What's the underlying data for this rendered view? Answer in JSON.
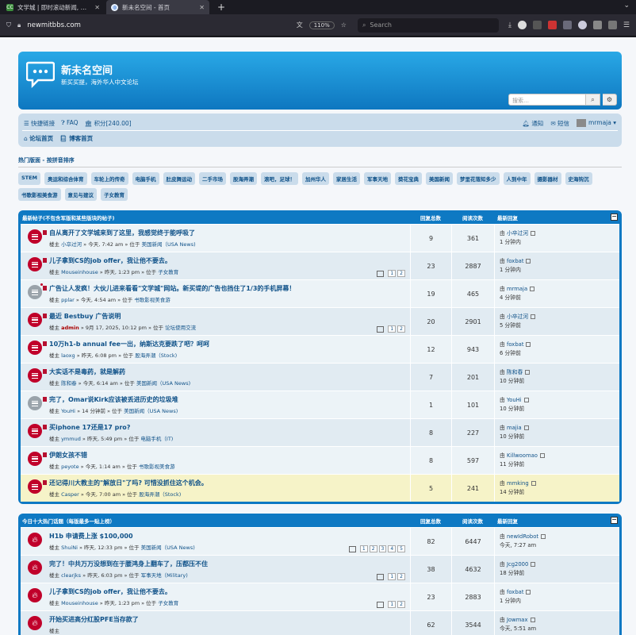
{
  "browser": {
    "tabs": [
      {
        "favicon": "CC",
        "title": "文学城 | 即时滚动新闻, 本地新闻,",
        "active": false
      },
      {
        "favicon": "globe",
        "title": "新未名空间 - 首页",
        "active": true
      }
    ],
    "url": "newmitbbs.com",
    "zoom": "110%",
    "search_placeholder": "Search",
    "ext_badge": "2"
  },
  "site": {
    "title": "新未名空间",
    "desc": "新买买提，海外华人中文论坛",
    "search_placeholder": "搜索…"
  },
  "nav": {
    "quicklinks": "快捷链接",
    "faq": "FAQ",
    "points": "积分[240.00]",
    "notify": "通知",
    "pm": "短信",
    "user": "mrmaja",
    "forum_home": "论坛首页",
    "blog_home": "博客首页"
  },
  "hot": {
    "title": "热门版面 - 按拼音排序",
    "tags": [
      "STEM",
      "奥运和综合体育",
      "车轮上的传奇",
      "电脑手机",
      "肚皮舞运动",
      "二手市场",
      "股海弄潮",
      "滚吧，足球！",
      "加州华人",
      "家居生活",
      "军事天地",
      "葵花宝典",
      "美国新闻",
      "梦里花落知多少",
      "人到中年",
      "摄影器材",
      "史海钩沉",
      "书歌影视美食游",
      "意见与建议",
      "子女教育"
    ]
  },
  "box1": {
    "header": "最新帖子(不包含军版和某些版块的帖子)",
    "col_replies": "回复总数",
    "col_views": "阅读次数",
    "col_last": "最新回复",
    "rows": [
      {
        "title": "自从离开了文学城来到了这里，我感觉终于能呼吸了",
        "prefix": "楼主",
        "author": "小卒过河",
        "time": "» 今天, 7:42 am » 位于",
        "forum": "美国新闻（USA News)",
        "replies": "9",
        "views": "361",
        "last_user": "小卒过河",
        "last_time": "1 分钟内",
        "last_prefix": "由",
        "pages": [],
        "admin": false
      },
      {
        "title": "儿子拿到CS的job offer，我让他不要去。",
        "prefix": "楼主",
        "author": "Mouseinhouse",
        "time": "» 昨天, 1:23 pm » 位于",
        "forum": "子女教育",
        "replies": "23",
        "views": "2887",
        "last_user": "foxbat",
        "last_time": "1 分钟内",
        "last_prefix": "由",
        "pages": [
          "1",
          "2"
        ],
        "admin": false
      },
      {
        "title": "广告让人发疯！大伙儿进来看看\"文学城\"网站。新买堤的广告也挡住了1/3的手机屏幕！",
        "prefix": "楼主",
        "author": "pplar",
        "time": "» 今天, 4:54 am » 位于",
        "forum": "书歌影视美食游",
        "replies": "19",
        "views": "465",
        "last_user": "mrmaja",
        "last_time": "4 分钟前",
        "last_prefix": "由",
        "pages": [],
        "admin": false
      },
      {
        "title": "最近 Bestbuy 广告说明",
        "prefix": "楼主",
        "author": "admin",
        "time": "» 9月 17, 2025, 10:12 pm » 位于",
        "forum": "论坛使用交流",
        "replies": "20",
        "views": "2901",
        "last_user": "小卒过河",
        "last_time": "5 分钟前",
        "last_prefix": "由",
        "pages": [
          "1",
          "2"
        ],
        "admin": true
      },
      {
        "title": "10万h1-b annual fee一出，纳斯达克要跌了吧？呵呵",
        "prefix": "楼主",
        "author": "laoxg",
        "time": "» 昨天, 6:08 pm » 位于",
        "forum": "股海弄潮（Stock)",
        "replies": "12",
        "views": "943",
        "last_user": "foxbat",
        "last_time": "6 分钟前",
        "last_prefix": "由",
        "pages": [],
        "admin": false
      },
      {
        "title": "大实话不是毒药，就是解药",
        "prefix": "楼主",
        "author": "陈和春",
        "time": "» 今天, 6:14 am » 位于",
        "forum": "美国新闻（USA News)",
        "replies": "7",
        "views": "201",
        "last_user": "陈和春",
        "last_time": "10 分钟前",
        "last_prefix": "由",
        "pages": [],
        "admin": false
      },
      {
        "title": "完了，Omar说Kirk应该被丢进历史的垃圾堆",
        "prefix": "楼主",
        "author": "YouHi",
        "time": "» 14 分钟前 » 位于",
        "forum": "美国新闻（USA News)",
        "replies": "1",
        "views": "101",
        "last_user": "YouHi",
        "last_time": "10 分钟前",
        "last_prefix": "由",
        "pages": [],
        "admin": false
      },
      {
        "title": "买iphone 17还是17 pro?",
        "prefix": "楼主",
        "author": "ymmud",
        "time": "» 昨天, 5:49 pm » 位于",
        "forum": "电脑手机（IT)",
        "replies": "8",
        "views": "227",
        "last_user": "majia",
        "last_time": "10 分钟前",
        "last_prefix": "由",
        "pages": [],
        "admin": false
      },
      {
        "title": "伊朗女孩不错",
        "prefix": "楼主",
        "author": "peyote",
        "time": "» 今天, 1:14 am » 位于",
        "forum": "书歌影视美食游",
        "replies": "8",
        "views": "597",
        "last_user": "Killwoomao",
        "last_time": "11 分钟前",
        "last_prefix": "由",
        "pages": [],
        "admin": false
      },
      {
        "title": "还记得川大教主的\"解放日\"了吗? 可惜没抓住这个机会。",
        "prefix": "楼主",
        "author": "Casper",
        "time": "» 今天, 7:00 am » 位于",
        "forum": "股海弄潮（Stock)",
        "replies": "5",
        "views": "241",
        "last_user": "mmking",
        "last_time": "14 分钟前",
        "last_prefix": "由",
        "pages": [],
        "admin": false
      }
    ]
  },
  "box2": {
    "header": "今日十大热门话题（每版最多一贴上榜）",
    "col_replies": "回复总数",
    "col_views": "阅读次数",
    "col_last": "最新回复",
    "rows": [
      {
        "title": "H1b 申请费上涨 $100,000",
        "prefix": "楼主",
        "author": "ShuiNi",
        "time": "» 昨天, 12:33 pm » 位于",
        "forum": "美国新闻（USA News)",
        "replies": "82",
        "views": "6447",
        "last_user": "newIdRobot",
        "last_time": "今天, 7:27 am",
        "last_prefix": "由",
        "pages": [
          "1",
          "2",
          "3",
          "4",
          "5"
        ],
        "admin": false
      },
      {
        "title": "完了！中共万万没想到在于腰鸿身上翻车了，压都压不住",
        "prefix": "楼主",
        "author": "clearjks",
        "time": "» 昨天, 6:03 pm » 位于",
        "forum": "军事天地（Military)",
        "replies": "38",
        "views": "4632",
        "last_user": "Jcg2000",
        "last_time": "18 分钟前",
        "last_prefix": "由",
        "pages": [
          "1",
          "2"
        ],
        "admin": false
      },
      {
        "title": "儿子拿到CS的job offer，我让他不要去。",
        "prefix": "楼主",
        "author": "Mouseinhouse",
        "time": "» 昨天, 1:23 pm » 位于",
        "forum": "子女教育",
        "replies": "23",
        "views": "2883",
        "last_user": "foxbat",
        "last_time": "1 分钟内",
        "last_prefix": "由",
        "pages": [
          "1",
          "2"
        ],
        "admin": false
      },
      {
        "title": "开始买进高分红股PFE当存款了",
        "prefix": "楼主",
        "author": "",
        "time": "",
        "forum": "",
        "replies": "62",
        "views": "3544",
        "last_user": "Jowmax",
        "last_time": "今天, 5:51 am",
        "last_prefix": "由",
        "pages": [],
        "admin": false
      }
    ]
  }
}
